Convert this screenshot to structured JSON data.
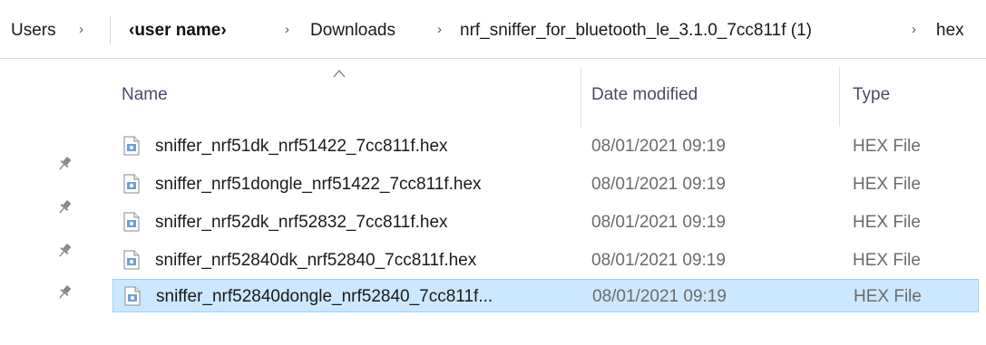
{
  "breadcrumb": {
    "users": "Users",
    "user_name": "‹user name›",
    "downloads": "Downloads",
    "folder": "nrf_sniffer_for_bluetooth_le_3.1.0_7cc811f (1)",
    "current": "hex",
    "separator": "›"
  },
  "columns": {
    "name": "Name",
    "date_modified": "Date modified",
    "type": "Type"
  },
  "files": [
    {
      "name": "sniffer_nrf51dk_nrf51422_7cc811f.hex",
      "date": "08/01/2021 09:19",
      "type": "HEX File",
      "icon": "hex-file-icon",
      "selected": false
    },
    {
      "name": "sniffer_nrf51dongle_nrf51422_7cc811f.hex",
      "date": "08/01/2021 09:19",
      "type": "HEX File",
      "icon": "hex-file-icon",
      "selected": false
    },
    {
      "name": "sniffer_nrf52dk_nrf52832_7cc811f.hex",
      "date": "08/01/2021 09:19",
      "type": "HEX File",
      "icon": "hex-file-icon",
      "selected": false
    },
    {
      "name": "sniffer_nrf52840dk_nrf52840_7cc811f.hex",
      "date": "08/01/2021 09:19",
      "type": "HEX File",
      "icon": "hex-file-icon",
      "selected": false
    },
    {
      "name": "sniffer_nrf52840dongle_nrf52840_7cc811f...",
      "date": "08/01/2021 09:19",
      "type": "HEX File",
      "icon": "hex-file-icon",
      "selected": true
    }
  ],
  "colors": {
    "selection_bg": "#cce8ff",
    "selection_border": "#99d1ff"
  }
}
